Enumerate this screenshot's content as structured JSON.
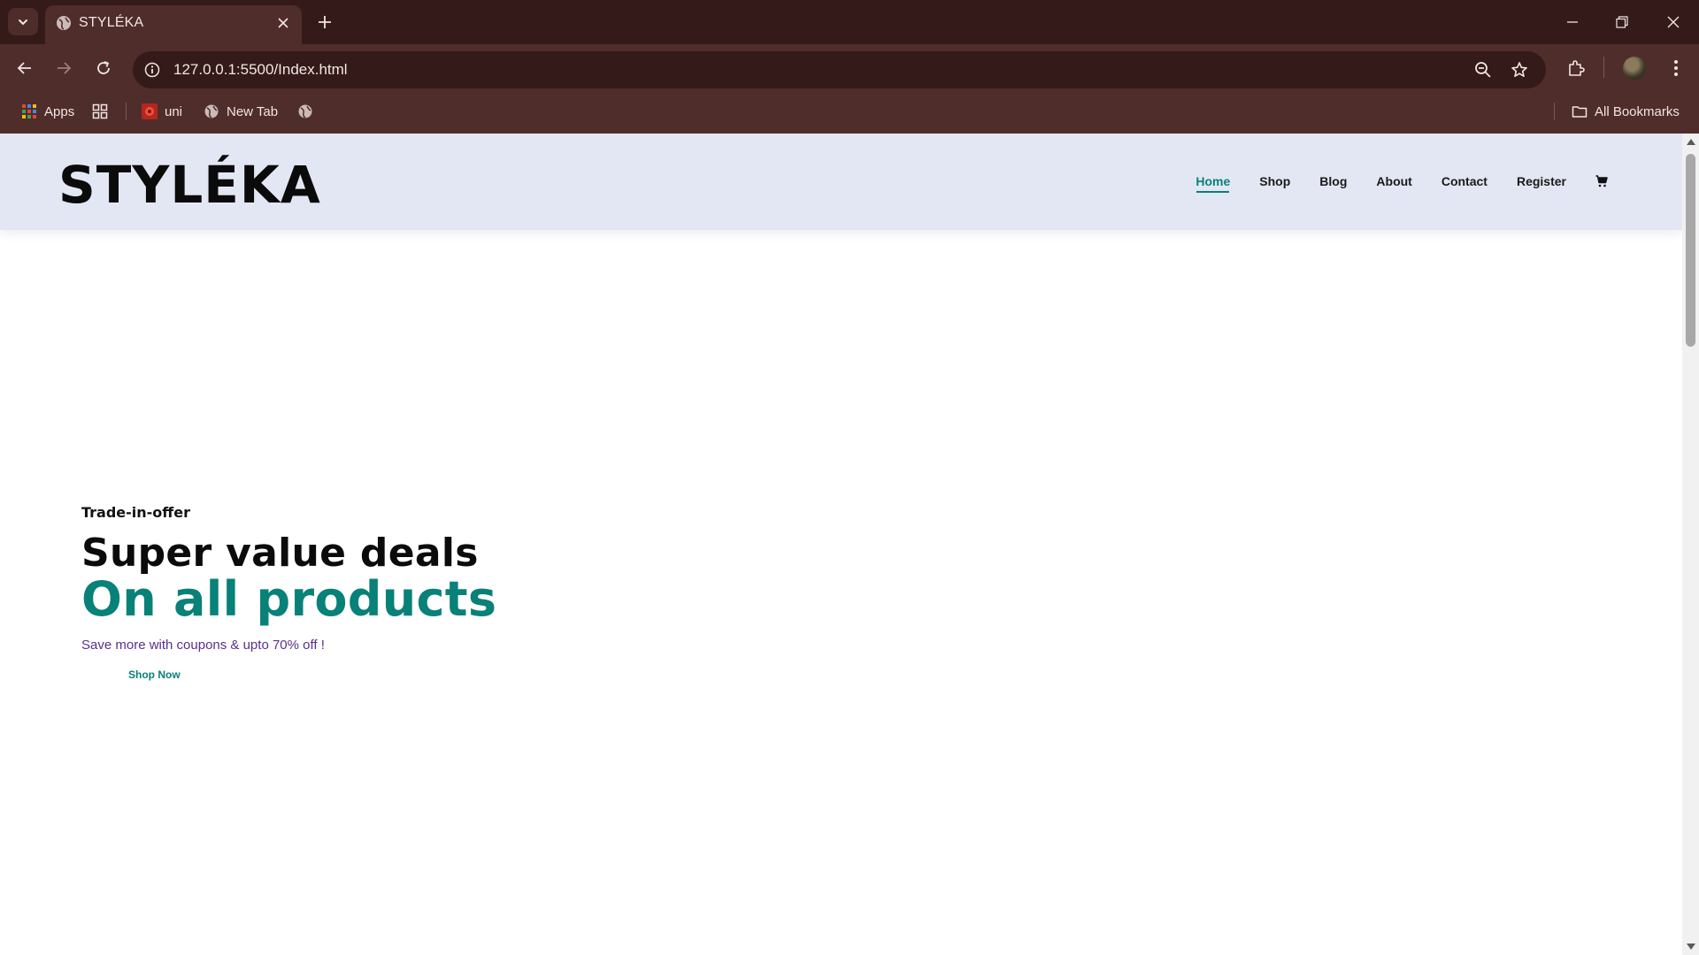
{
  "browser": {
    "tab": {
      "title": "STYLÉKA"
    },
    "url": "127.0.0.1:5500/Index.html",
    "bookmarks": [
      {
        "label": "Apps",
        "icon": "apps-grid-icon"
      },
      {
        "label": "",
        "icon": "tab-groups-icon"
      },
      {
        "label": "uni",
        "icon": "uni-favicon-icon"
      },
      {
        "label": "New Tab",
        "icon": "globe-icon"
      },
      {
        "label": "",
        "icon": "globe-icon"
      }
    ],
    "all_bookmarks": "All Bookmarks"
  },
  "site": {
    "logo": "STYLÉKA",
    "nav": [
      {
        "label": "Home",
        "active": true
      },
      {
        "label": "Shop",
        "active": false
      },
      {
        "label": "Blog",
        "active": false
      },
      {
        "label": "About",
        "active": false
      },
      {
        "label": "Contact",
        "active": false
      },
      {
        "label": "Register",
        "active": false
      }
    ],
    "accent_color": "#088178"
  },
  "hero": {
    "kicker": "Trade-in-offer",
    "headline": "Super value deals",
    "subheadline": "On all products",
    "text": "Save more with coupons & upto 70% off !",
    "button": "Shop Now"
  }
}
